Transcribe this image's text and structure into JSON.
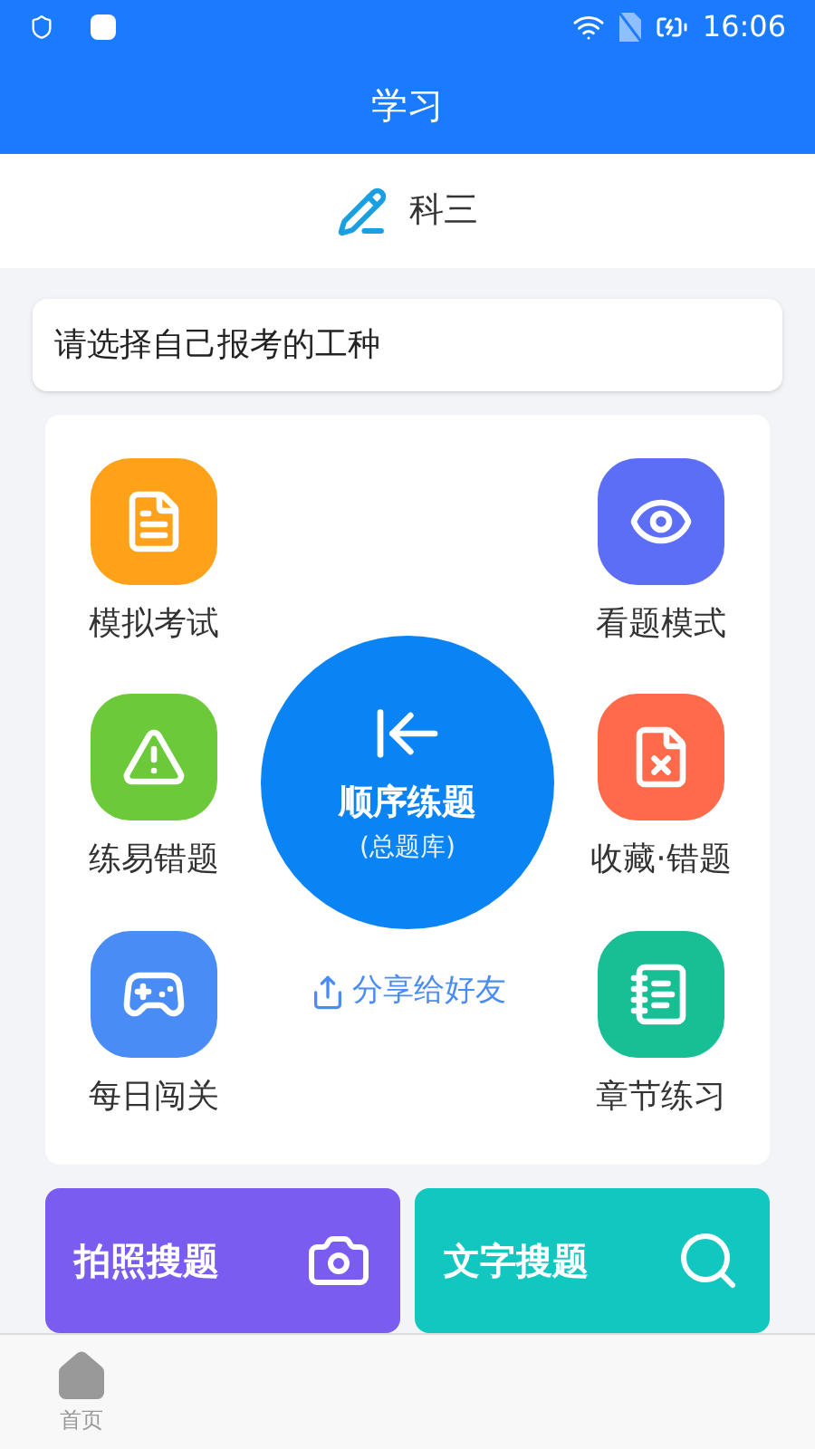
{
  "status_bar": {
    "time": "16:06"
  },
  "header": {
    "title": "学习"
  },
  "subject": {
    "label": "科三"
  },
  "job_select": {
    "placeholder": "请选择自己报考的工种"
  },
  "modes": [
    {
      "label": "模拟考试",
      "color": "#ffa21a"
    },
    {
      "label": "看题模式",
      "color": "#5b6ef5"
    },
    {
      "label": "练易错题",
      "color": "#6cc93a"
    },
    {
      "label": "收藏·错题",
      "color": "#ff6a4a"
    },
    {
      "label": "每日闯关",
      "color": "#4a8cf5"
    },
    {
      "label": "章节练习",
      "color": "#19bf94"
    }
  ],
  "main_practice": {
    "title": "顺序练题",
    "subtitle": "(总题库)"
  },
  "share": {
    "label": "分享给好友"
  },
  "search_cards": [
    {
      "label": "拍照搜题",
      "color": "#7b5cf0"
    },
    {
      "label": "文字搜题",
      "color": "#12c7c0"
    }
  ],
  "bottom_nav": [
    {
      "label": "首页",
      "selected": false
    }
  ]
}
